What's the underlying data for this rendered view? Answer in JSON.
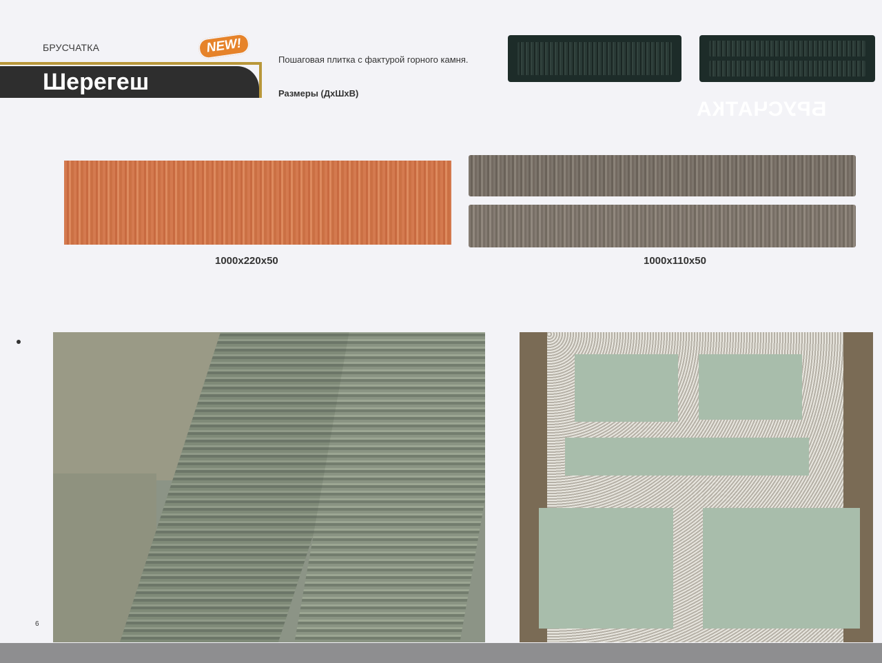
{
  "header": {
    "category": "БРУСЧАТКА",
    "badge": "NEW!",
    "title": "Шерегеш",
    "description": "Пошаговая плитка с фактурой горного камня.",
    "sizes_label": "Размеры (ДхШхВ)",
    "watermark": "БРУСЧАТКА"
  },
  "products": [
    {
      "size": "1000x220x50",
      "color": "#d47a4f"
    },
    {
      "size": "1000x110x50",
      "color": "#7d756c"
    }
  ],
  "footer": {
    "page_number": "6"
  }
}
